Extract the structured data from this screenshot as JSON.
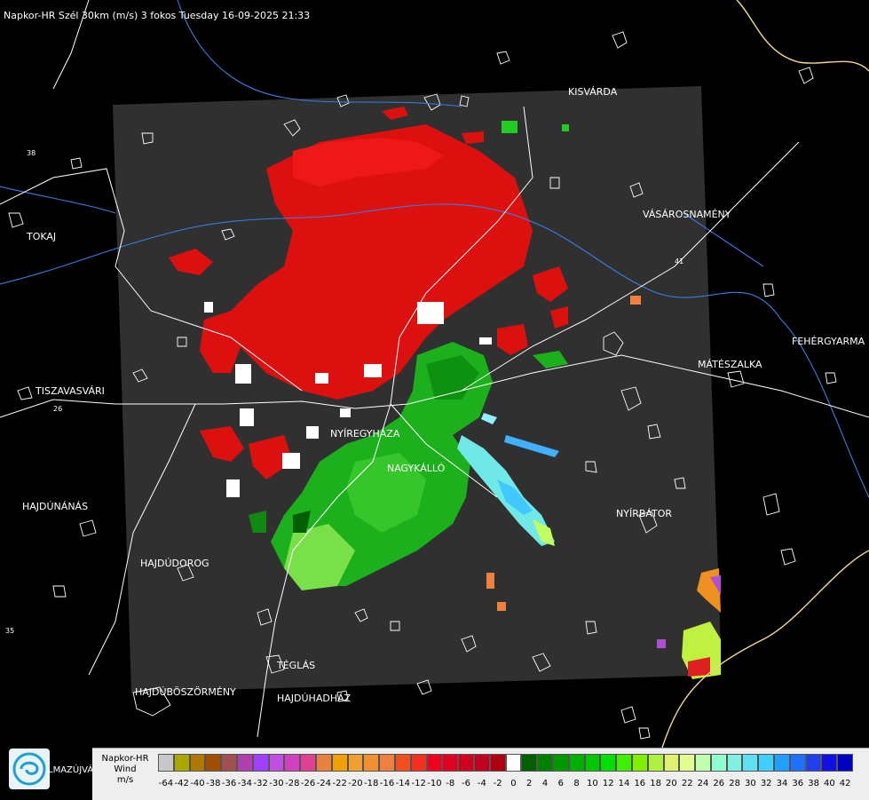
{
  "title": "Napkor-HR Szél 30km (m/s) 3 fokos Tuesday 16-09-2025 21:33",
  "cities": [
    {
      "id": "kisvarda",
      "name": "KISVÁRDA"
    },
    {
      "id": "tokaj",
      "name": "TOKAJ"
    },
    {
      "id": "vasarosnameny",
      "name": "VÁSÁROSNAMÉNY"
    },
    {
      "id": "fehergyarmat",
      "name": "FEHÉRGYARMA"
    },
    {
      "id": "mateszalka",
      "name": "MÁTÉSZALKA"
    },
    {
      "id": "tiszavasvari",
      "name": "TISZAVASVÁRI"
    },
    {
      "id": "nyiregyhaza",
      "name": "NYÍREGYHÁZA"
    },
    {
      "id": "nagykallo",
      "name": "NAGYKÁLLÓ"
    },
    {
      "id": "hajdunanas",
      "name": "HAJDÚNÁNÁS"
    },
    {
      "id": "nyirbator",
      "name": "NYÍRBÁTOR"
    },
    {
      "id": "hajdudorog",
      "name": "HAJDÚDOROG"
    },
    {
      "id": "teglas",
      "name": "TÉGLÁS"
    },
    {
      "id": "hajduboszormeny",
      "name": "HAJDÚBÖSZÖRMÉNY"
    },
    {
      "id": "hajduhadhaz",
      "name": "HAJDÚHADHÁZ"
    },
    {
      "id": "almazujvar",
      "name": "LMAZÚJVÁR"
    }
  ],
  "road_numbers": [
    "38",
    "26",
    "41",
    "35"
  ],
  "legend": {
    "line1": "Napkor-HR",
    "line2": "Wind",
    "line3": "m/s",
    "ticks": [
      "-64",
      "-42",
      "-40",
      "-38",
      "-36",
      "-34",
      "-32",
      "-30",
      "-28",
      "-26",
      "-24",
      "-22",
      "-20",
      "-18",
      "-16",
      "-14",
      "-12",
      "-10",
      "-8",
      "-6",
      "-4",
      "-2",
      "0",
      "2",
      "4",
      "6",
      "8",
      "10",
      "12",
      "14",
      "16",
      "18",
      "20",
      "22",
      "24",
      "26",
      "28",
      "30",
      "32",
      "34",
      "36",
      "38",
      "40",
      "42"
    ],
    "colors": [
      "#c8c8c8",
      "#a8a800",
      "#b07800",
      "#a05000",
      "#a05050",
      "#b040b0",
      "#a040ff",
      "#c050e0",
      "#d040c0",
      "#e04090",
      "#e88040",
      "#f0a000",
      "#f0a030",
      "#f09030",
      "#f08040",
      "#f05020",
      "#f03020",
      "#f00020",
      "#e00020",
      "#d00020",
      "#c00020",
      "#b00010",
      "#ffffff",
      "#006000",
      "#008000",
      "#009800",
      "#00b000",
      "#00c800",
      "#00e000",
      "#40f000",
      "#80f000",
      "#b0f040",
      "#e0f070",
      "#e0ff90",
      "#c0ffb0",
      "#90ffd0",
      "#80f0e0",
      "#60e0f0",
      "#40d0ff",
      "#20a0ff",
      "#2070ff",
      "#2040f0",
      "#1010e0",
      "#0000c0"
    ]
  }
}
